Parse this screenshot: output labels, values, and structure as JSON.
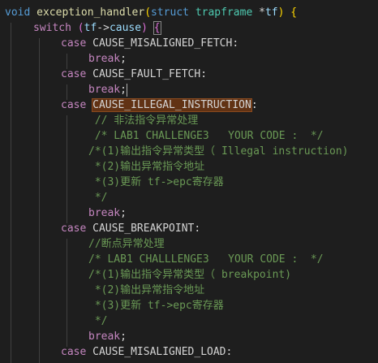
{
  "code": {
    "l01": {
      "kw": "void",
      "fn": "exception_handler",
      "p1": "(",
      "kw2": "struct",
      "ty": "trapframe",
      "ptr": " *",
      "var": "tf",
      "p2": ")",
      "brace": "{"
    },
    "l02": {
      "kw": "switch",
      "p1": "(",
      "var": "tf",
      "arrow": "->",
      "var2": "cause",
      "p2": ")",
      "brace": "{"
    },
    "l03": {
      "kw": "case",
      "txt": "CAUSE_MISALIGNED_FETCH:"
    },
    "l04": {
      "kw": "break",
      "txt": ";"
    },
    "l05": {
      "kw": "case",
      "txt": "CAUSE_FAULT_FETCH:"
    },
    "l06": {
      "kw": "break",
      "txt": ";"
    },
    "l07": {
      "kw": "case",
      "hl": "CAUSE_ILLEGAL_INSTRUCTION",
      "txt": ":"
    },
    "l08": {
      "cm": " // 非法指令异常处理"
    },
    "l09": {
      "cm": " /* LAB1 CHALLENGE3   YOUR CODE :  */"
    },
    "l10": {
      "cm": "/*(1)输出指令异常类型（ Illegal instruction)"
    },
    "l11": {
      "cm": " *(2)输出异常指令地址"
    },
    "l12": {
      "cm": " *(3)更新 tf->epc寄存器"
    },
    "l13": {
      "cm": " */"
    },
    "l14": {
      "kw": "break",
      "txt": ";"
    },
    "l15": {
      "kw": "case",
      "txt": "CAUSE_BREAKPOINT:"
    },
    "l16": {
      "cm": "//断点异常处理"
    },
    "l17": {
      "cm": "/* LAB1 CHALLLENGE3   YOUR CODE :  */"
    },
    "l18": {
      "cm": "/*(1)输出指令异常类型（ breakpoint)"
    },
    "l19": {
      "cm": " *(2)输出异常指令地址"
    },
    "l20": {
      "cm": " *(3)更新 tf->epc寄存器"
    },
    "l21": {
      "cm": " */"
    },
    "l22": {
      "kw": "break",
      "txt": ";"
    },
    "l23": {
      "kw": "case",
      "txt": "CAUSE_MISALIGNED_LOAD:"
    }
  }
}
